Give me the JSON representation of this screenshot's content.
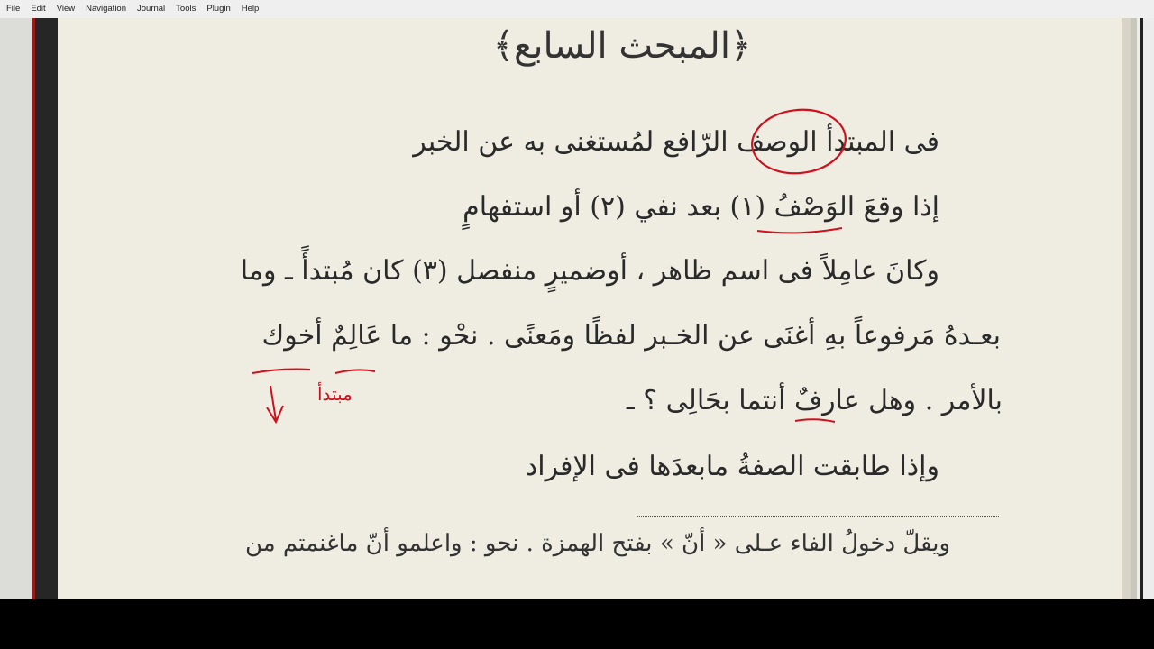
{
  "menu": {
    "items": [
      "File",
      "Edit",
      "View",
      "Navigation",
      "Journal",
      "Tools",
      "Plugin",
      "Help"
    ]
  },
  "document": {
    "title": "﴿المبحث السابع﴾",
    "lines": [
      "فى المبتدأ الوصف الرّافع لمُستغنى به عن الخبر",
      "إذا وقعَ الوَصْفُ (١) بعد نفي (٢) أو استفهامٍ",
      "وكانَ عامِلاً فى اسم ظاهر ، أوضميرٍ منفصل (٣) كان مُبتدأً ـ وما",
      "بعـدهُ مَرفوعاً بهِ أغنَى عن الخـبر لفظًا ومَعنًى . نحْو : ما عَالِمٌ أخوك",
      "بالأمر . وهل عارفٌ أنتما بحَالِى ؟ ـ",
      "وإذا طابقت الصفةُ مابعدَها فى الإفراد"
    ],
    "footnote": "ويقلّ دخولُ الفاء عـلى « أنّ » بفتح الهمزة . نحو : واعلمو أنّ ماغنمتم من",
    "handwritten_annotation": "مبتدأ"
  },
  "colors": {
    "annotation_red": "#d0101c",
    "page_background": "#efece1",
    "text": "#2a2a2a"
  }
}
